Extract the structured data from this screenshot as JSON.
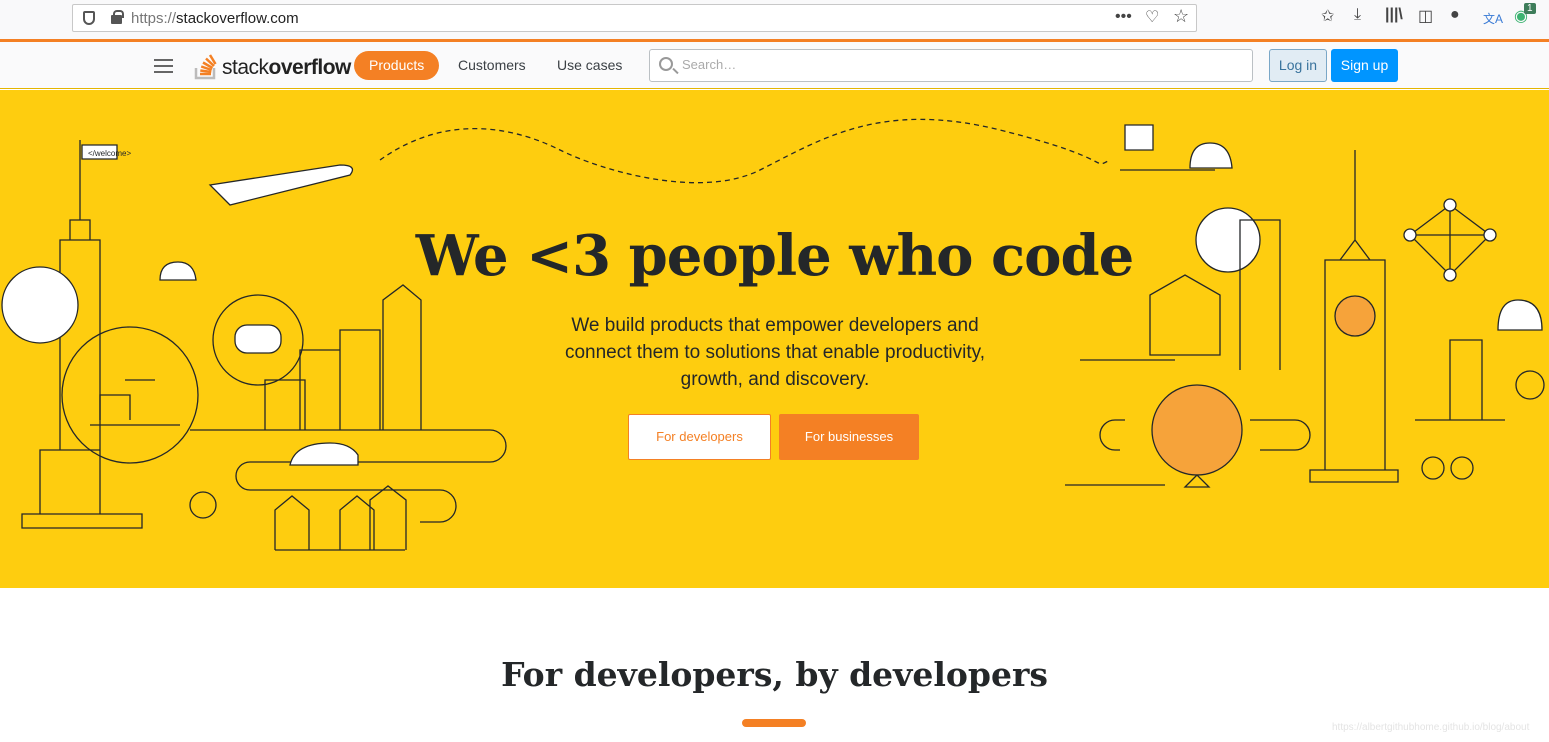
{
  "browser": {
    "url_prefix": "https://",
    "url_host": "stackoverflow.com",
    "icons": [
      "shield-icon",
      "lock-icon",
      "more-icon",
      "pocket-icon",
      "star-icon",
      "bookmarks-icon",
      "download-icon",
      "library-icon",
      "sidebar-icon",
      "account-icon",
      "translate-icon",
      "extension-icon"
    ],
    "extension_badge": "1"
  },
  "nav": {
    "logo_light": "stack",
    "logo_bold": "overflow",
    "items": [
      {
        "label": "Products",
        "active": true
      },
      {
        "label": "Customers"
      },
      {
        "label": "Use cases"
      }
    ],
    "search_placeholder": "Search…",
    "login": "Log in",
    "signup": "Sign up"
  },
  "hero": {
    "title": "We <3 people who code",
    "subtitle": "We build products that empower developers and connect them to solutions that enable productivity, growth, and discovery.",
    "btn_developers": "For developers",
    "btn_businesses": "For businesses",
    "flag_text": "</welcome>"
  },
  "section": {
    "title": "For developers, by developers"
  },
  "watermark": "https://albertgithubhome.github.io/blog/about",
  "colors": {
    "accent": "#f48024",
    "hero_bg": "#fecd0f",
    "signup": "#0095ff"
  }
}
